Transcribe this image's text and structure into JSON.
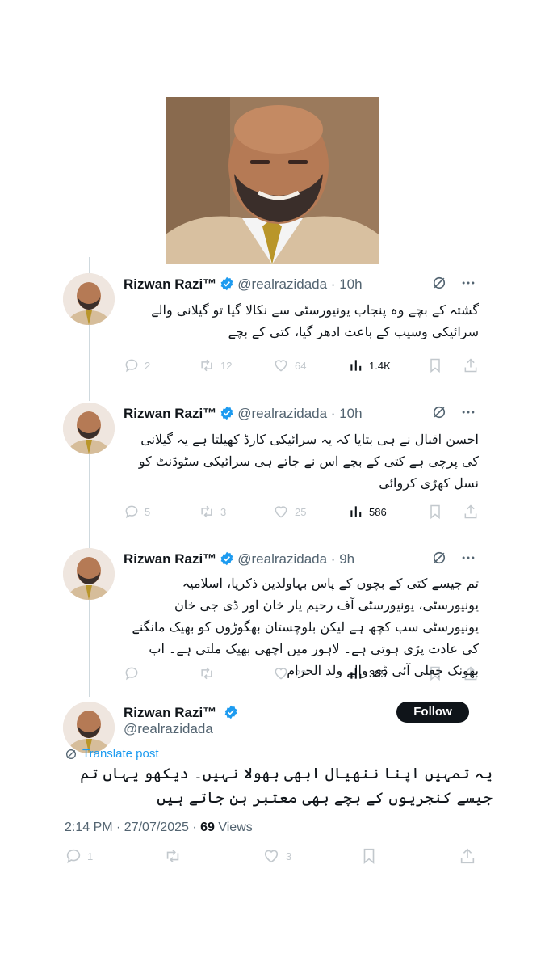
{
  "tweets": [
    {
      "name": "Rizwan Razi™",
      "handle": "@realrazidada",
      "time": "10h",
      "text": "گشتہ کے بچے وہ پنجاب یونیورسٹی سے نکالا گیا تو گیلانی والے سرائیکی وسیب کے باعث ادھر گیا، کتی کے بچے",
      "replies": "2",
      "retweets": "12",
      "likes": "64",
      "views": "1.4K"
    },
    {
      "name": "Rizwan Razi™",
      "handle": "@realrazidada",
      "time": "10h",
      "text": "احسن اقبال نے ہی بتایا کہ یہ سرائیکی کارڈ کھیلتا ہے یہ گیلانی کی پرچی ہے کتی کے بچے اس نے جاتے ہی سرائیکی سٹوڈنٹ کو نسل کھڑی کروائی",
      "replies": "5",
      "retweets": "3",
      "likes": "25",
      "views": "586"
    },
    {
      "name": "Rizwan Razi™",
      "handle": "@realrazidada",
      "time": "9h",
      "text": "تم جیسے کتی کے بچوں کے پاس بہاولدین ذکریا، اسلامیہ یونیورسٹی، یونیورسٹی آف رحیم یار خان اور ڈی جی خان یونیورسٹی سب کچھ ہے لیکن بلوچستان بھگوڑوں کو بھیک مانگنے کی عادت پڑی ہوتی ہے۔ لاہور میں اچھی بھیک ملتی ہے۔ اب بھونک جعلی آئی ڈی والے ولد الحرام",
      "replies": "",
      "retweets": "",
      "likes": "22",
      "views": "385"
    }
  ],
  "main": {
    "name": "Rizwan Razi™",
    "handle": "@realrazidada",
    "follow_label": "Follow",
    "translate_label": "Translate post",
    "text": "یہ تمہیں اپنا ننھیال ابھی بھولا نہیں۔ دیکھو یہاں تم جیسے کنجریوں کے بچے بھی معتبر بن جاتے ہیں",
    "time": "2:14 PM · 27/07/2025 · ",
    "views_count": "69",
    "views_label": " Views",
    "replies": "1",
    "likes": "3"
  },
  "colors": {
    "accent": "#1d9bf0",
    "text": "#0f1419",
    "muted": "#536471",
    "line": "#cfd9de"
  }
}
